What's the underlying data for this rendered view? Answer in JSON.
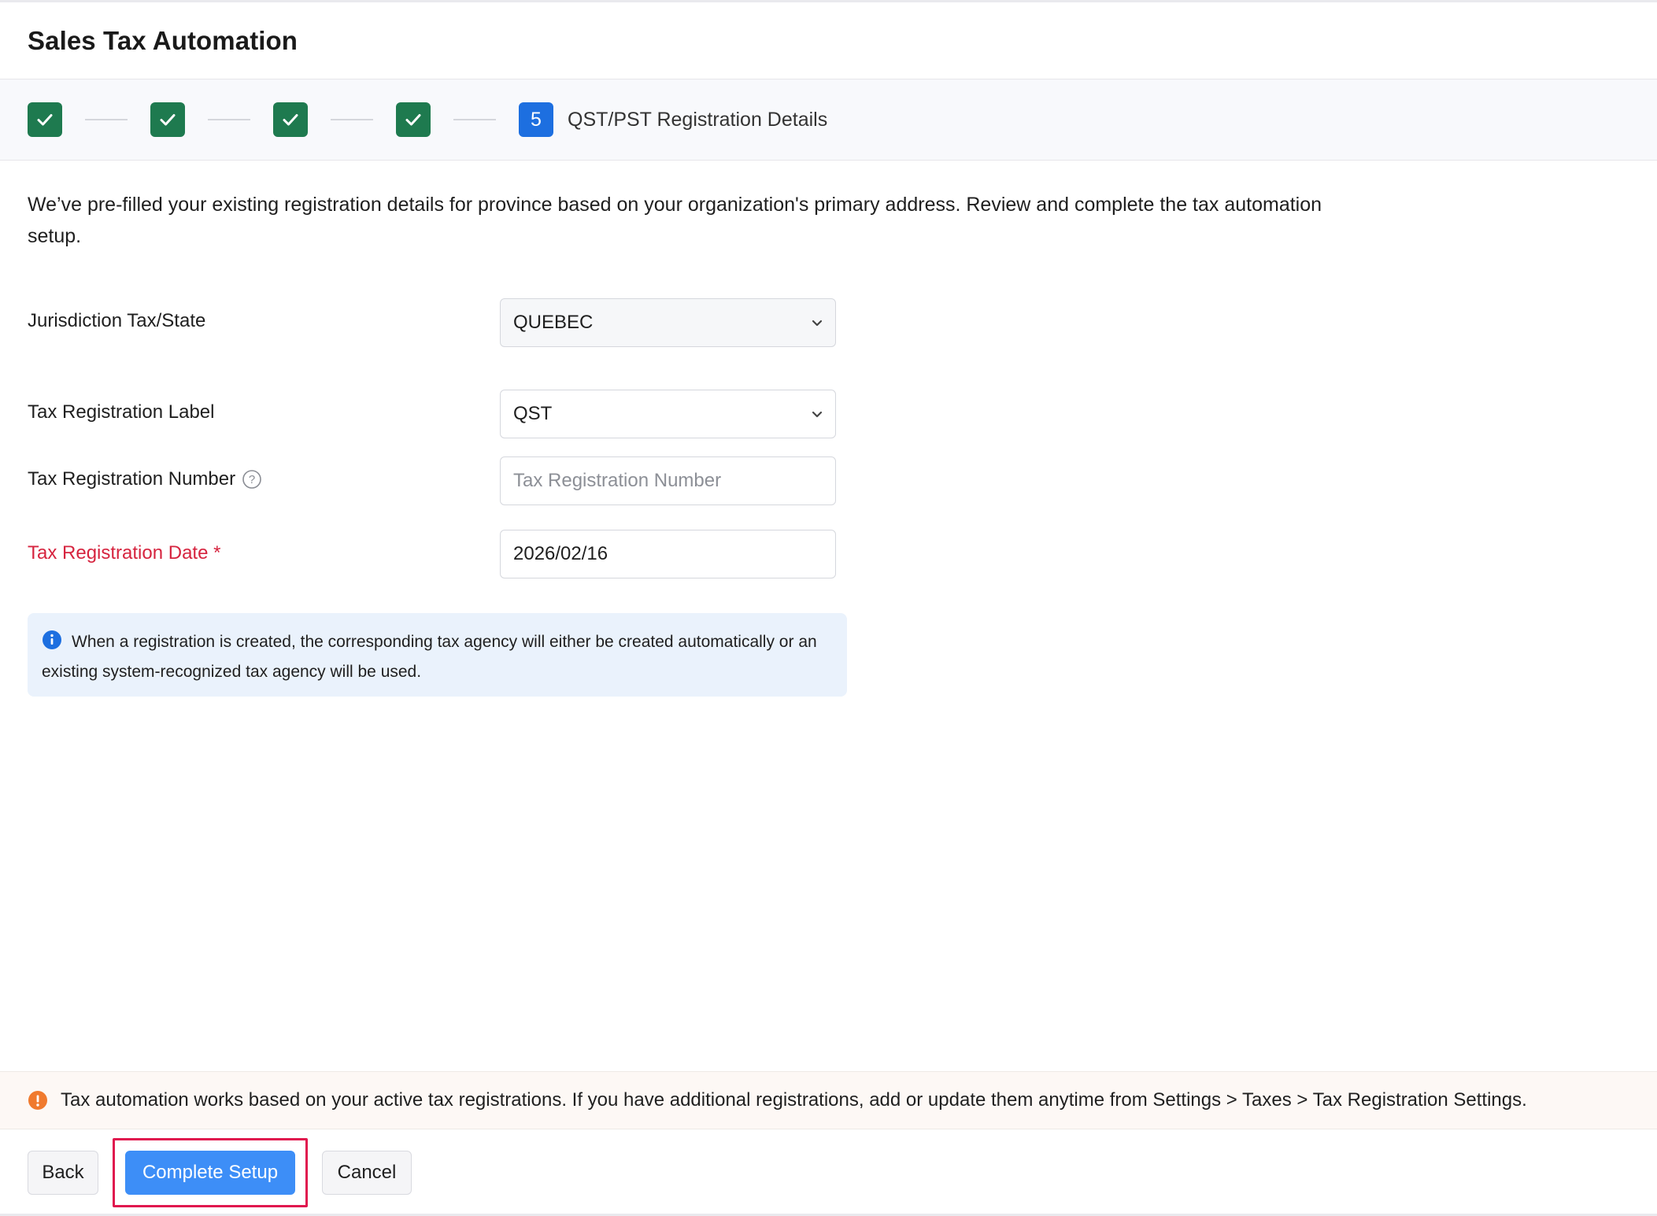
{
  "header": {
    "title": "Sales Tax Automation"
  },
  "stepper": {
    "completed_steps": 4,
    "current_step_number": "5",
    "current_step_label": "QST/PST Registration Details"
  },
  "intro_text": "We’ve pre-filled your existing registration details for province based on your organization's primary address. Review and complete the tax automation setup.",
  "form": {
    "jurisdiction": {
      "label": "Jurisdiction Tax/State",
      "value": "QUEBEC"
    },
    "reg_label": {
      "label": "Tax Registration Label",
      "value": "QST"
    },
    "reg_number": {
      "label": "Tax Registration Number",
      "placeholder": "Tax Registration Number",
      "value": ""
    },
    "reg_date": {
      "label": "Tax Registration Date *",
      "value": "2026/02/16"
    }
  },
  "info_box": {
    "text": "When a registration is created, the corresponding tax agency will either be created automatically or an existing system-recognized tax agency will be used."
  },
  "footer_note": {
    "text": "Tax automation works based on your active tax registrations. If you have additional registrations, add or update them anytime from Settings > Taxes > Tax Registration Settings."
  },
  "actions": {
    "back": "Back",
    "complete": "Complete Setup",
    "cancel": "Cancel"
  },
  "colors": {
    "step_done": "#1e7a4f",
    "step_current": "#1d6fe0",
    "required_label": "#d6243f",
    "primary_button": "#3d8ef7",
    "highlight_outline": "#e0174e",
    "info_bg": "#eaf2fc",
    "warn_icon": "#f07a2e"
  }
}
